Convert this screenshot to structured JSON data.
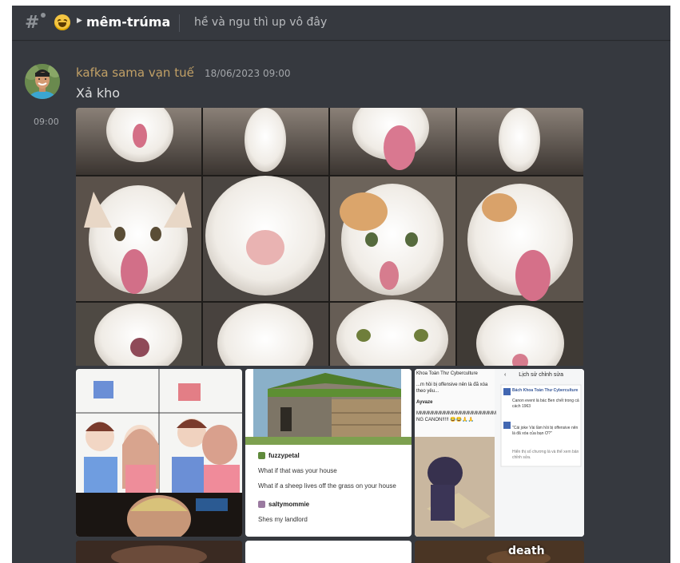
{
  "header": {
    "thread_icon": "thread-icon",
    "channel_emoji": "rolling-on-floor-laughing-emoji",
    "channel_name": "mêm-trúma",
    "topic": "hề và ngu thì up vô đây"
  },
  "message": {
    "author": "kafka sama vạn tuế",
    "timestamp": "18/06/2023 09:00",
    "content": "Xả kho",
    "side_time": "09:00",
    "author_color": "#c1a066"
  },
  "attachments": {
    "tumblr": {
      "user1": "fuzzypetal",
      "line1": "What if that was your house",
      "line2": "What if a sheep lives off the grass on your house",
      "user2": "saltymommie",
      "line3": "Shes my landlord"
    },
    "screenshot": {
      "header_left": "Khoa Toàn Thư Cyberculture",
      "header_right": "Lịch sử chỉnh sửa",
      "line1": "...m hồi bị offensive nên là đã xóa theo yêu...",
      "line2": "Ayvaze",
      "line3": "MMMMMMMMMMMMMMMMMMMM",
      "line4": "NG CANON!!!!! 😂😂🙏🙏",
      "post_title": "Bách Khoa Toàn Thư Cyberculture",
      "post_text1": "Canon event là bác Ben chết trong cả cách 1963",
      "post_text2": "\"Cái joke Vài lầm hồi bị offensive nên là đã xóa của bạn Ơ?\"",
      "footer": "Hiển thị số chương là và thể xem bản chỉnh sửa."
    },
    "bottom_caption": "death"
  }
}
